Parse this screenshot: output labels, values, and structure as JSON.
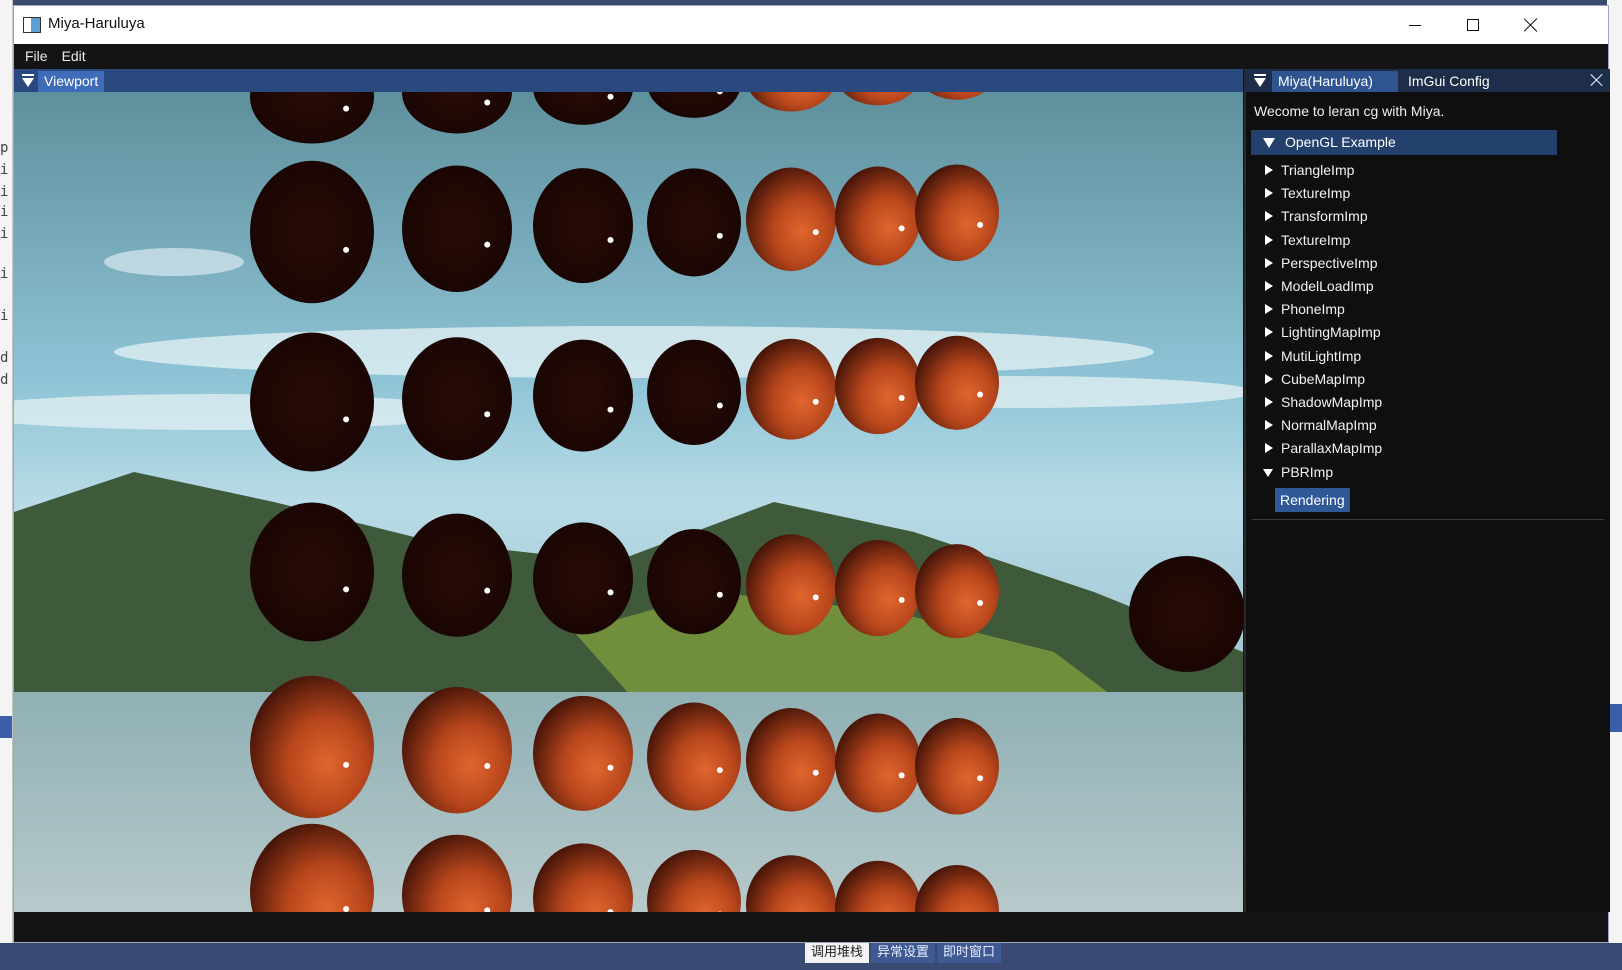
{
  "window": {
    "title": "Miya-Haruluya",
    "controls": {
      "minimize": "minimize-icon",
      "maximize": "maximize-icon",
      "close": "close-icon"
    }
  },
  "menubar": {
    "items": [
      "File",
      "Edit"
    ]
  },
  "viewport": {
    "tab_label": "Viewport"
  },
  "side_panel": {
    "tabs": [
      "Miya(Haruluya)",
      "ImGui Config"
    ],
    "welcome_text": "Wecome to leran cg with Miya.",
    "tree": {
      "root_label": "OpenGL Example",
      "items": [
        "TriangleImp",
        "TextureImp",
        "TransformImp",
        "TextureImp",
        "PerspectiveImp",
        "ModelLoadImp",
        "PhoneImp",
        "LightingMapImp",
        "MutiLightImp",
        "CubeMapImp",
        "ShadowMapImp",
        "NormalMapImp",
        "ParallaxMapImp",
        "PBRImp"
      ],
      "expanded_item": "PBRImp",
      "child_button": "Rendering"
    }
  },
  "host_bottom_tabs": [
    "调用堆栈",
    "异常设置",
    "即时窗口"
  ],
  "colors": {
    "titlebar": "#ffffff",
    "menubar": "#141414",
    "tab_bar": "#2a4a7f",
    "active_tab": "#3f6cb8",
    "tree_root_bg": "#24416e",
    "button_bg": "#2e5896",
    "sphere": "#c24a1e"
  }
}
